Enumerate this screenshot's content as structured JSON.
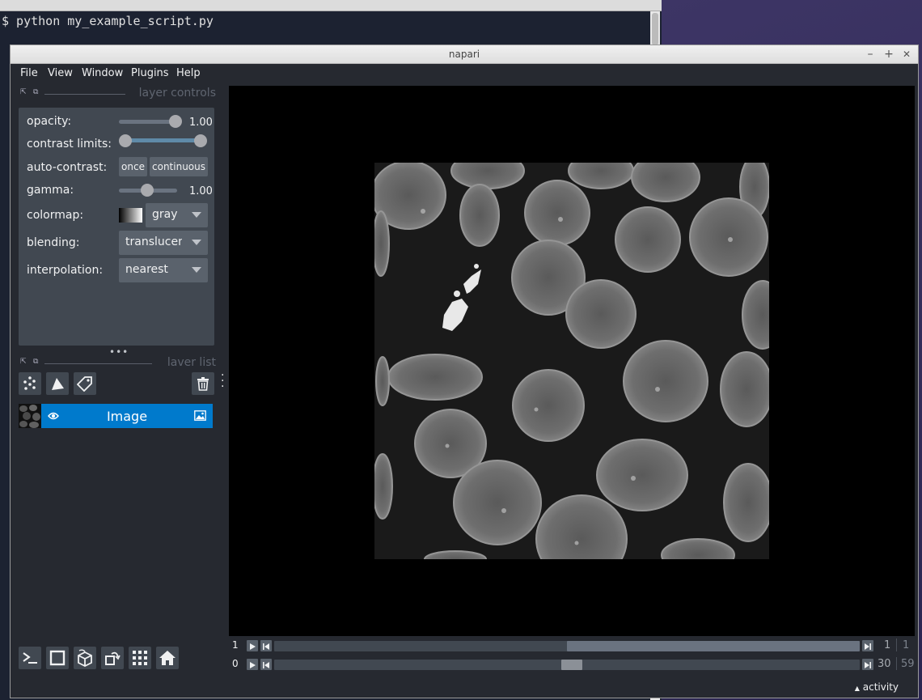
{
  "terminal": {
    "command_line": "$ python my_example_script.py"
  },
  "window": {
    "title": "napari",
    "minimize": "–",
    "maximize": "+",
    "close": "✕"
  },
  "menubar": {
    "file": "File",
    "view": "View",
    "window": "Window",
    "plugins": "Plugins",
    "help": "Help"
  },
  "layer_controls": {
    "header": "layer controls",
    "opacity_label": "opacity:",
    "opacity_value": "1.00",
    "opacity_level": 1.0,
    "contrast_limits_label": "contrast limits:",
    "contrast_limits_range": [
      0.0,
      1.0
    ],
    "auto_contrast_label": "auto-contrast:",
    "auto_contrast_once": "once",
    "auto_contrast_continuous": "continuous",
    "gamma_label": "gamma:",
    "gamma_value": "1.00",
    "colormap_label": "colormap:",
    "colormap_value": "gray",
    "blending_label": "blending:",
    "blending_value": "translucent",
    "interpolation_label": "interpolation:",
    "interpolation_value": "nearest"
  },
  "layer_list": {
    "header": "laver list",
    "layers": [
      {
        "name": "Image",
        "visible": true,
        "selected": true,
        "type_icon": "image-icon"
      }
    ]
  },
  "dims": [
    {
      "axis_index": "1",
      "current": "1",
      "max": "1",
      "thumb_start_fraction": 0.5,
      "thumb_end_fraction": 1.0
    },
    {
      "axis_index": "0",
      "current": "30",
      "max": "59",
      "position_fraction": 0.508
    }
  ],
  "status": {
    "activity": "activity"
  },
  "colors": {
    "window_bg": "#262930",
    "panel_bg": "#414851",
    "selected_layer": "#007acc",
    "text": "#f0f1f2"
  }
}
